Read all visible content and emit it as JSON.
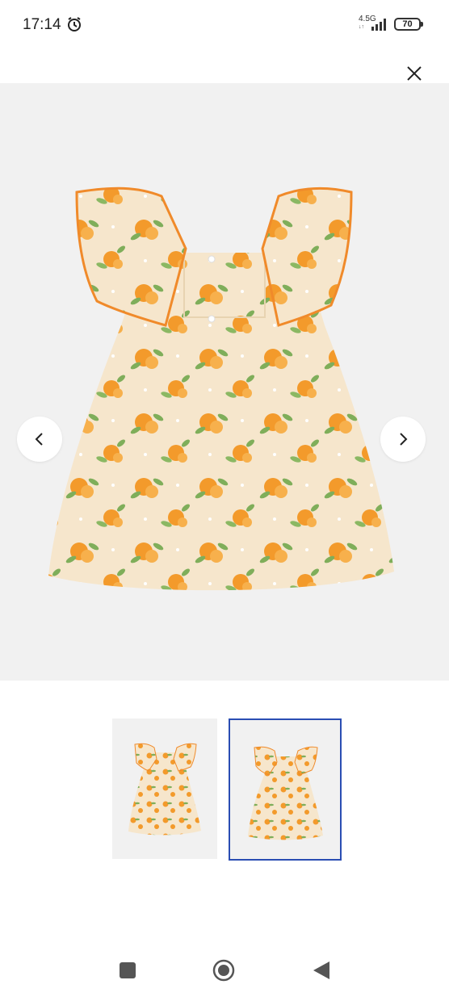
{
  "status_bar": {
    "time": "17:14",
    "network": "4.5G",
    "network_sub": "↓↑",
    "battery": "70"
  },
  "product_gallery": {
    "main_image_alt": "orange-print-dress",
    "thumbnails": [
      "thumbnail-1",
      "thumbnail-2"
    ],
    "selected_thumbnail_index": 1
  },
  "icons": {
    "alarm": "alarm-icon",
    "signal": "signal-icon",
    "close": "close-icon",
    "prev": "chevron-left-icon",
    "next": "chevron-right-icon",
    "recents": "square-icon",
    "home": "circle-icon",
    "back": "back-triangle-icon"
  },
  "colors": {
    "dress": "#f6e6cc",
    "orange": "#f39a2b",
    "leaf": "#7fae5a",
    "selected_border": "#2a4db3",
    "image_bg": "#f1f1f1"
  }
}
